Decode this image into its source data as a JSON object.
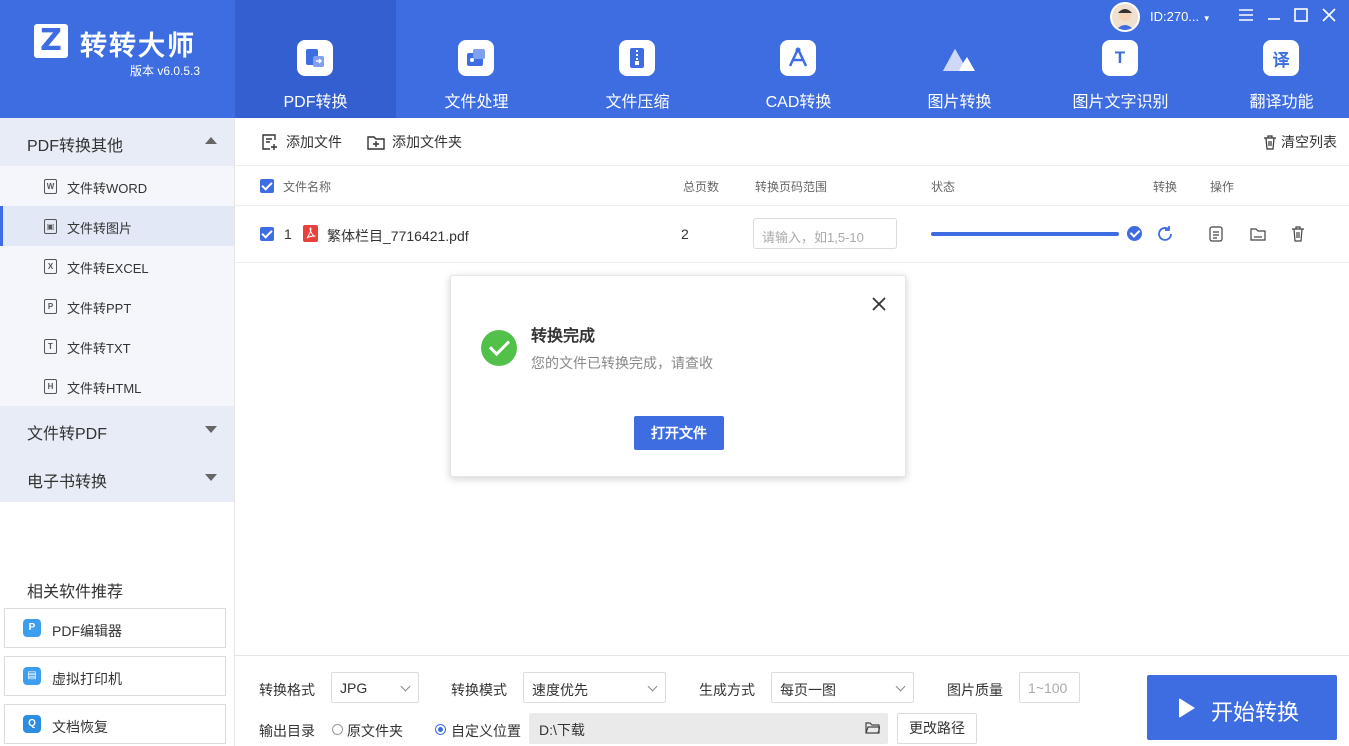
{
  "app": {
    "logo_letter": "Z",
    "name": "转转大师",
    "version": "版本 v6.0.5.3",
    "user_id": "ID:270...",
    "brand_color": "#3d6de1"
  },
  "nav_tabs": [
    {
      "label": "PDF转换",
      "icon": "pdf-convert-icon",
      "active": true
    },
    {
      "label": "文件处理",
      "icon": "file-process-icon"
    },
    {
      "label": "文件压缩",
      "icon": "zip-icon"
    },
    {
      "label": "CAD转换",
      "icon": "cad-icon"
    },
    {
      "label": "图片转换",
      "icon": "image-icon"
    },
    {
      "label": "图片文字识别",
      "icon": "text-ocr-icon",
      "glyph": "T"
    },
    {
      "label": "翻译功能",
      "icon": "translate-icon",
      "glyph": "译"
    }
  ],
  "sidebar": {
    "groups": [
      {
        "label": "PDF转换其他",
        "expanded": true
      },
      {
        "label": "文件转PDF",
        "expanded": false
      },
      {
        "label": "电子书转换",
        "expanded": false
      }
    ],
    "items": [
      {
        "label": "文件转WORD",
        "glyph": "W",
        "icon": "word-file-icon"
      },
      {
        "label": "文件转图片",
        "glyph": "▣",
        "icon": "image-file-icon",
        "selected": true
      },
      {
        "label": "文件转EXCEL",
        "glyph": "X",
        "icon": "excel-file-icon"
      },
      {
        "label": "文件转PPT",
        "glyph": "P",
        "icon": "ppt-file-icon"
      },
      {
        "label": "文件转TXT",
        "glyph": "T",
        "icon": "txt-file-icon"
      },
      {
        "label": "文件转HTML",
        "glyph": "H",
        "icon": "html-file-icon"
      }
    ],
    "recommend_title": "相关软件推荐",
    "recommend": [
      {
        "label": "PDF编辑器",
        "glyph": "P",
        "icon": "pdf-editor-icon"
      },
      {
        "label": "虚拟打印机",
        "glyph": "▤",
        "icon": "printer-icon"
      },
      {
        "label": "文档恢复",
        "glyph": "Q",
        "icon": "recovery-icon"
      }
    ]
  },
  "toolbar": {
    "add_file": "添加文件",
    "add_folder": "添加文件夹",
    "clear_list": "清空列表"
  },
  "table": {
    "headers": {
      "name": "文件名称",
      "pages": "总页数",
      "range": "转换页码范围",
      "status": "状态",
      "convert": "转换",
      "actions": "操作"
    },
    "rows": [
      {
        "index": "1",
        "file_name": "繁体栏目_7716421.pdf",
        "pages": "2",
        "range_placeholder": "请输入，如1,5-10",
        "progress": 1.0
      }
    ]
  },
  "dialog": {
    "title": "转换完成",
    "message": "您的文件已转换完成，请查收",
    "button": "打开文件"
  },
  "bottom": {
    "format_label": "转换格式",
    "format_value": "JPG",
    "mode_label": "转换模式",
    "mode_value": "速度优先",
    "gen_label": "生成方式",
    "gen_value": "每页一图",
    "quality_label": "图片质量",
    "quality_placeholder": "1~100",
    "output_label": "输出目录",
    "radio_original": "原文件夹",
    "radio_custom": "自定义位置",
    "path": "D:\\下载",
    "change_path": "更改路径",
    "start": "开始转换"
  }
}
